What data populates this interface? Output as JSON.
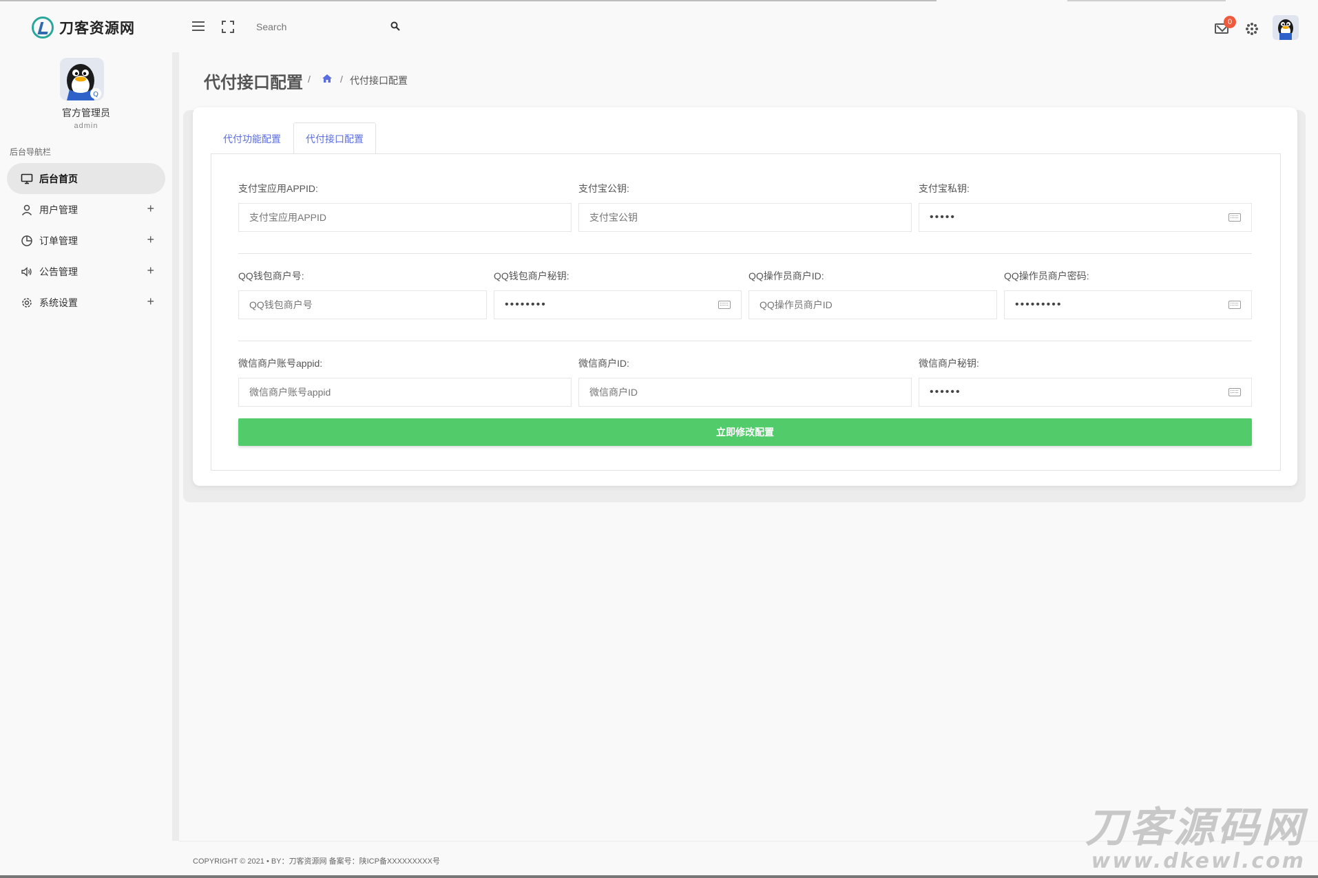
{
  "app": {
    "brand": "刀客资源网"
  },
  "search": {
    "placeholder": "Search"
  },
  "header": {
    "mail_badge": "0"
  },
  "user": {
    "name": "官方管理员",
    "role": "admin"
  },
  "sidebar": {
    "title": "后台导航栏",
    "items": [
      {
        "label": "后台首页",
        "active": true,
        "icon": "monitor-icon"
      },
      {
        "label": "用户管理",
        "active": false,
        "icon": "user-icon"
      },
      {
        "label": "订单管理",
        "active": false,
        "icon": "pie-chart-icon"
      },
      {
        "label": "公告管理",
        "active": false,
        "icon": "speaker-icon"
      },
      {
        "label": "系统设置",
        "active": false,
        "icon": "gear-icon"
      }
    ]
  },
  "page": {
    "title": "代付接口配置",
    "breadcrumb_sep": "/",
    "breadcrumb_current": "代付接口配置"
  },
  "tabs": [
    {
      "label": "代付功能配置",
      "active": false
    },
    {
      "label": "代付接口配置",
      "active": true
    }
  ],
  "form": {
    "alipay_appid": {
      "label": "支付宝应用APPID:",
      "placeholder": "支付宝应用APPID"
    },
    "alipay_pubkey": {
      "label": "支付宝公钥:",
      "placeholder": "支付宝公钥"
    },
    "alipay_privkey": {
      "label": "支付宝私钥:",
      "value": "•••••"
    },
    "qq_merchant_no": {
      "label": "QQ钱包商户号:",
      "placeholder": "QQ钱包商户号"
    },
    "qq_merchant_secret": {
      "label": "QQ钱包商户秘钥:",
      "value": "••••••••"
    },
    "qq_operator_id": {
      "label": "QQ操作员商户ID:",
      "placeholder": "QQ操作员商户ID"
    },
    "qq_operator_password": {
      "label": "QQ操作员商户密码:",
      "value": "•••••••••"
    },
    "wx_appid": {
      "label": "微信商户账号appid:",
      "placeholder": "微信商户账号appid"
    },
    "wx_merchant_id": {
      "label": "微信商户ID:",
      "placeholder": "微信商户ID"
    },
    "wx_merchant_secret": {
      "label": "微信商户秘钥:",
      "value": "••••••"
    },
    "submit_label": "立即修改配置"
  },
  "footer": {
    "text": "COPYRIGHT © 2021 • BY：刀客资源网   备案号：陕ICP备XXXXXXXXX号"
  },
  "watermark": {
    "line1": "刀客源码网",
    "line2": "www.dkewl.com"
  },
  "colors": {
    "accent_blue": "#5b6ee1",
    "submit_green": "#52cc6a",
    "badge_red": "#f05a3c"
  }
}
